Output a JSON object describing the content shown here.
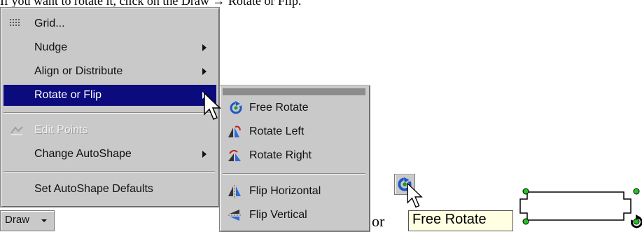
{
  "doc": {
    "top_text": "If you want to rotate it, click on the Draw → Rotate or Flip.",
    "or_text": "or"
  },
  "draw_menu": {
    "items": [
      {
        "label": "Grid..."
      },
      {
        "label": "Nudge"
      },
      {
        "label": "Align or Distribute"
      },
      {
        "label": "Rotate or Flip"
      },
      {
        "label": "Edit Points"
      },
      {
        "label": "Change AutoShape"
      },
      {
        "label": "Set AutoShape Defaults"
      }
    ]
  },
  "submenu": {
    "items": [
      {
        "label": "Free Rotate"
      },
      {
        "label": "Rotate Left"
      },
      {
        "label": "Rotate Right"
      },
      {
        "label": "Flip Horizontal"
      },
      {
        "label": "Flip Vertical"
      }
    ]
  },
  "draw_button": {
    "label": "Draw"
  },
  "tooltip": {
    "text": "Free Rotate"
  },
  "colors": {
    "menu_bg": "#c9c9c9",
    "highlight": "#0b0b7e",
    "tooltip_bg": "#ffffe1",
    "handle": "#22c422"
  }
}
